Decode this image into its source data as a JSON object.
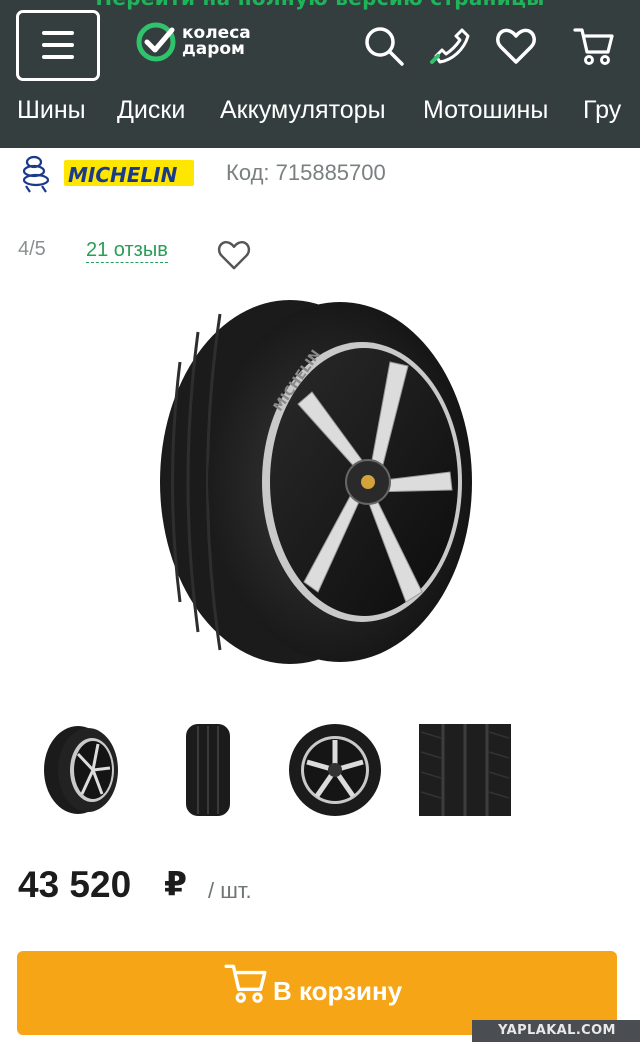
{
  "banner": {
    "text": "Перейти на полную версию страницы"
  },
  "header": {
    "logo": {
      "line1": "колеса",
      "line2": "даром"
    },
    "icons": [
      "menu-icon",
      "search-icon",
      "phone-icon",
      "heart-icon",
      "cart-icon"
    ]
  },
  "nav": {
    "items": [
      "Шины",
      "Диски",
      "Аккумуляторы",
      "Мотошины",
      "Гру"
    ]
  },
  "product": {
    "brand": "MICHELIN",
    "code": "Код: 715885700",
    "rating": "4/5",
    "reviews": "21 отзыв",
    "price": "43 520",
    "currency": "₽",
    "unit": "/ шт."
  },
  "actions": {
    "add_to_cart": "В корзину"
  },
  "watermark": "YAPLAKAL.COM",
  "colors": {
    "header_bg": "#343e3f",
    "accent_green": "#2a9d57",
    "cart_orange": "#f6a517"
  }
}
